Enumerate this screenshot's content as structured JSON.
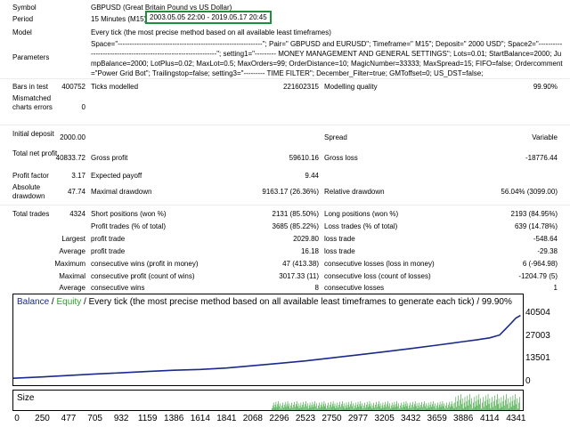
{
  "info": {
    "symbol_label": "Symbol",
    "symbol_value": "GBPUSD (Great Britain Pound vs US Dollar)",
    "period_label": "Period",
    "period_prefix": "15 Minutes (M15)",
    "period_range": "2003.05.05 22:00 - 2019.05.17 20:45",
    "model_label": "Model",
    "model_value": "Every tick (the most precise method based on all available least timeframes)",
    "parameters_label": "Parameters",
    "parameters_value": "Space=\"-------------------------------------------------------------\"; Pair=\" GBPUSD and EURUSD\"; Timeframe=\" M15\"; Deposit=\" 2000 USD\"; Space2=\"---------------------------------------------------------------\"; setting1=\"--------- MONEY MANAGEMENT AND GENERAL SETTINGS\"; Lots=0.01; StartBalance=2000; JumpBalance=2000; LotPlus=0.02; MaxLot=0.5; MaxOrders=99; OrderDistance=10; MagicNumber=33333; MaxSpread=15; FIFO=false; Ordercomment=\"Power Grid Bot\"; Trailingstop=false; setting3=\"--------- TIME FILTER\"; December_Filter=true; GMToffset=0; US_DST=false;"
  },
  "stats": {
    "bars_label": "Bars in test",
    "bars_value": "400752",
    "ticks_label": "Ticks modelled",
    "ticks_value": "221602315",
    "quality_label": "Modelling quality",
    "quality_value": "99.90%",
    "mismatch_label": "Mismatched charts errors",
    "mismatch_value": "0",
    "deposit_label": "Initial deposit",
    "deposit_value": "2000.00",
    "spread_label": "Spread",
    "spread_value": "Variable",
    "netprofit_label": "Total net profit",
    "netprofit_value": "40833.72",
    "grossprofit_label": "Gross profit",
    "grossprofit_value": "59610.16",
    "grossloss_label": "Gross loss",
    "grossloss_value": "-18776.44",
    "pf_label": "Profit factor",
    "pf_value": "3.17",
    "ep_label": "Expected payoff",
    "ep_value": "9.44",
    "absdd_label": "Absolute drawdown",
    "absdd_value": "47.74",
    "maxdd_label": "Maximal drawdown",
    "maxdd_value": "9163.17 (26.36%)",
    "reldd_label": "Relative drawdown",
    "reldd_value": "56.04% (3099.00)",
    "trades_label": "Total trades",
    "trades_value": "4324",
    "short_label": "Short positions (won %)",
    "short_value": "2131 (85.50%)",
    "long_label": "Long positions (won %)",
    "long_value": "2193 (84.95%)",
    "profittrades_label": "Profit trades (% of total)",
    "profittrades_value": "3685 (85.22%)",
    "losstrades_label": "Loss trades (% of total)",
    "losstrades_value": "639 (14.78%)",
    "largest_label": "Largest",
    "largest_profit_label": "profit trade",
    "largest_profit_value": "2029.80",
    "largest_loss_label": "loss trade",
    "largest_loss_value": "-548.64",
    "average_label": "Average",
    "average_profit_label": "profit trade",
    "average_profit_value": "16.18",
    "average_loss_label": "loss trade",
    "average_loss_value": "-29.38",
    "maximum_label": "Maximum",
    "max_wins_label": "consecutive wins (profit in money)",
    "max_wins_value": "47 (413.38)",
    "max_losses_label": "consecutive losses (loss in money)",
    "max_losses_value": "6 (-964.98)",
    "maximal_label": "Maximal",
    "maximal_profit_label": "consecutive profit (count of wins)",
    "maximal_profit_value": "3017.33 (11)",
    "maximal_loss_label": "consecutive loss (count of losses)",
    "maximal_loss_value": "-1204.79 (5)",
    "average2_label": "Average",
    "avg_wins_label": "consecutive wins",
    "avg_wins_value": "8",
    "avg_losses_label": "consecutive losses",
    "avg_losses_value": "1"
  },
  "chart": {
    "legend_balance": "Balance",
    "legend_sep": " / ",
    "legend_equity": "Equity",
    "legend_rest": " / Every tick (the most precise method based on all available least timeframes to generate each tick) / 99.90%",
    "size_label": "Size",
    "balance_color": "#1a2a8c",
    "equity_color": "#2e9e2e",
    "size_color": "#2e9e2e"
  },
  "chart_data": {
    "type": "line",
    "title": "",
    "xlabel": "",
    "ylabel": "",
    "ylim": [
      0,
      43000
    ],
    "xlim": [
      0,
      4400
    ],
    "yticks": [
      "40504",
      "27003",
      "13501",
      "0"
    ],
    "ytick_values": [
      40504,
      27003,
      13501,
      0
    ],
    "xticks": [
      "0",
      "250",
      "477",
      "705",
      "932",
      "1159",
      "1386",
      "1614",
      "1841",
      "2068",
      "2296",
      "2523",
      "2750",
      "2977",
      "3205",
      "3432",
      "3659",
      "3886",
      "4114",
      "4341"
    ],
    "xtick_values": [
      0,
      250,
      477,
      705,
      932,
      1159,
      1386,
      1614,
      1841,
      2068,
      2296,
      2523,
      2750,
      2977,
      3205,
      3432,
      3659,
      3886,
      4114,
      4341
    ],
    "series": [
      {
        "name": "Balance",
        "x": [
          0,
          250,
          477,
          705,
          932,
          1159,
          1386,
          1614,
          1841,
          2068,
          2296,
          2523,
          2750,
          2977,
          3205,
          3432,
          3659,
          3886,
          4000,
          4114,
          4200,
          4250,
          4300,
          4341,
          4380
        ],
        "values": [
          2000,
          2800,
          3600,
          4500,
          5200,
          6000,
          6700,
          7200,
          8000,
          9400,
          10800,
          12200,
          14000,
          15800,
          17600,
          19500,
          21500,
          23600,
          24600,
          25800,
          27500,
          31000,
          34500,
          37500,
          39000
        ]
      }
    ]
  }
}
